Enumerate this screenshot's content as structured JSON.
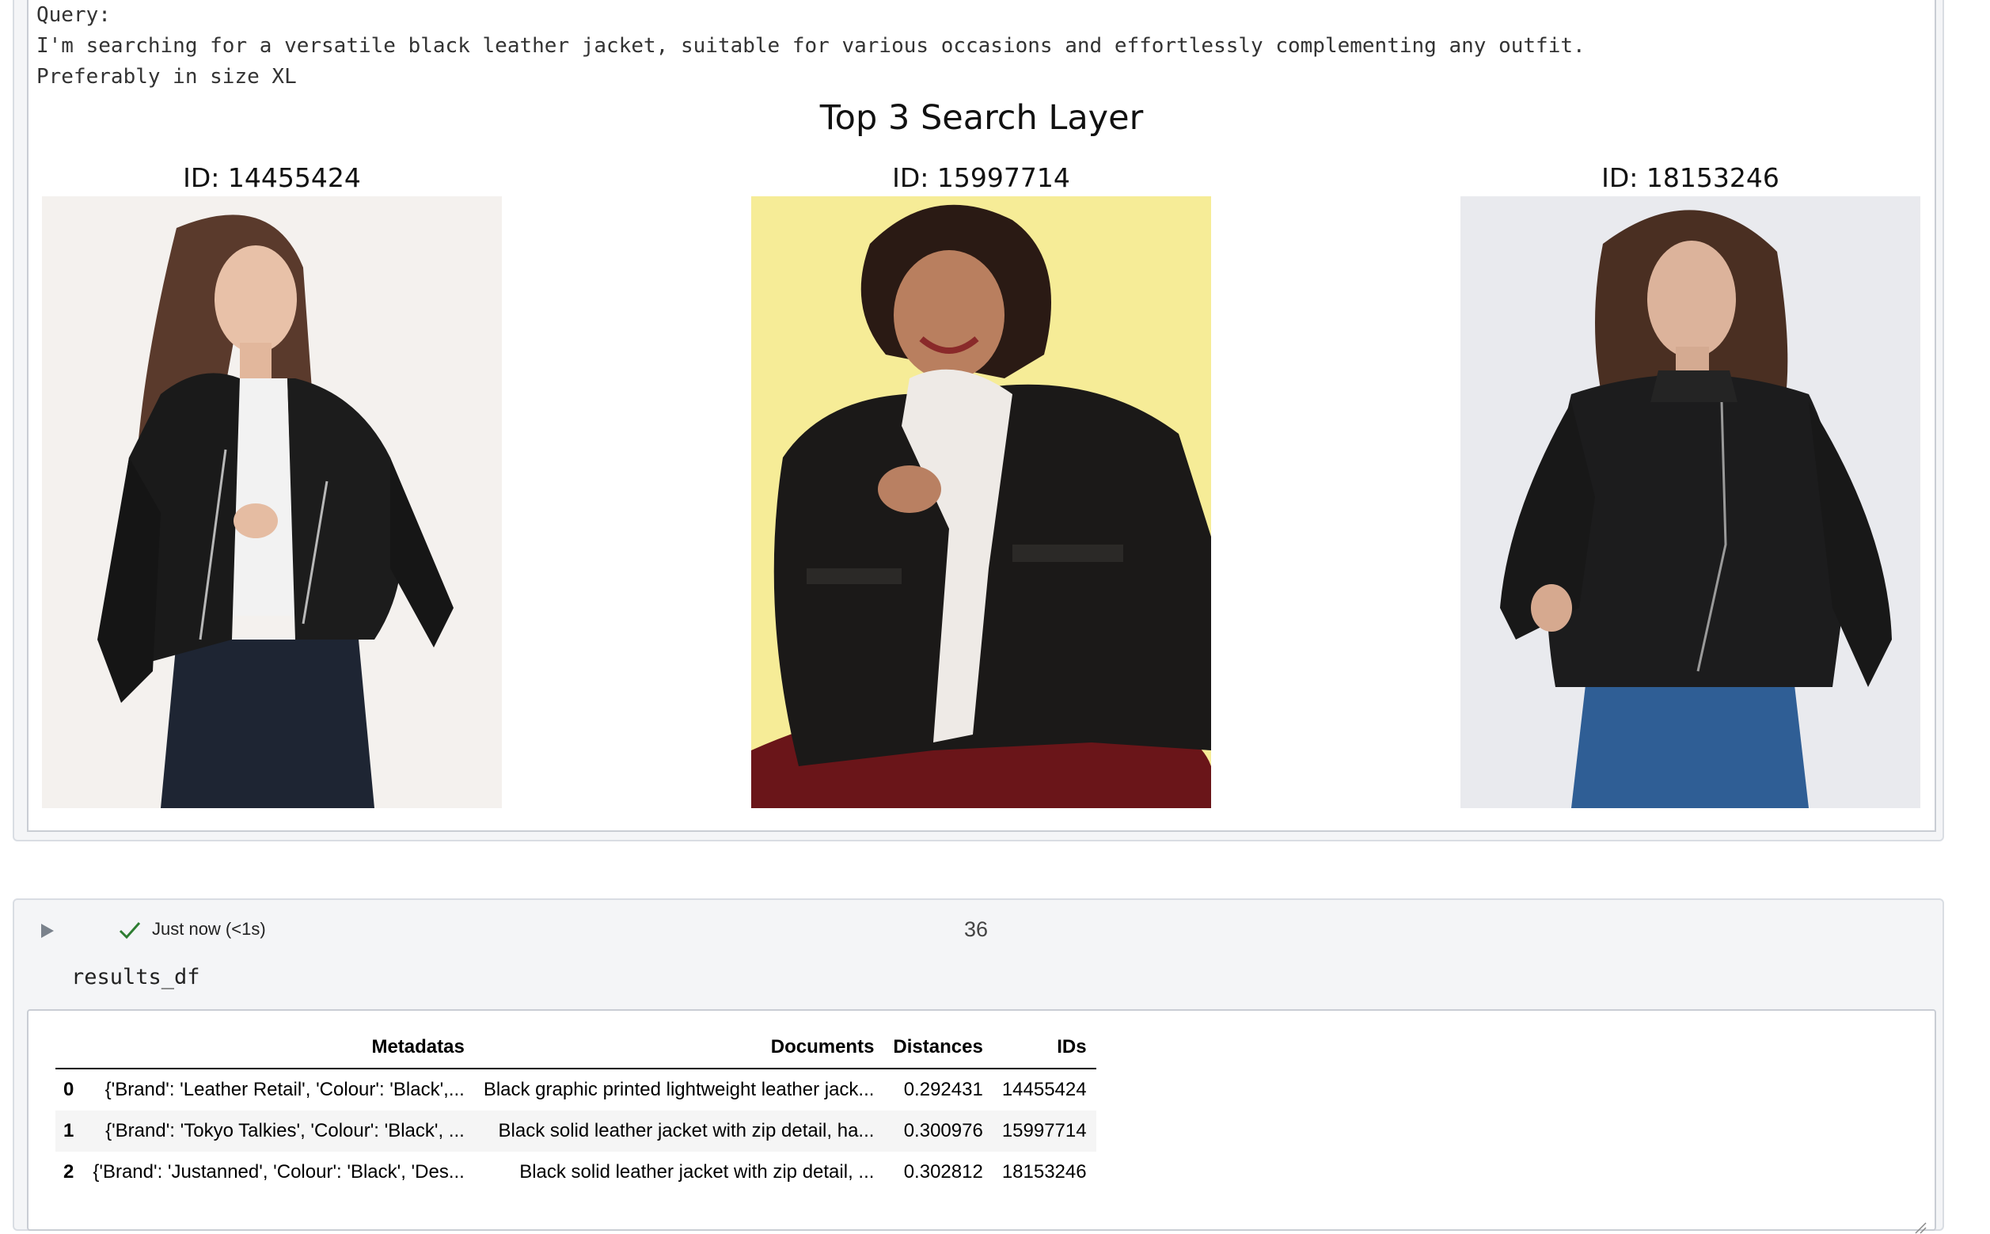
{
  "output": {
    "query_label": "Query:",
    "query_line1": "I'm searching for a versatile black leather jacket, suitable for various occasions and effortlessly complementing any outfit.",
    "query_line2": "Preferably in size XL",
    "figure_title": "Top 3 Search Layer",
    "panels": [
      {
        "id_label": "ID: 14455424",
        "image": "woman-in-black-leather-biker-jacket-photo"
      },
      {
        "id_label": "ID: 15997714",
        "image": "smiling-woman-in-black-leather-jacket-with-shearling-collar-photo"
      },
      {
        "id_label": "ID: 18153246",
        "image": "woman-in-black-leather-jacket-and-jeans-photo"
      }
    ]
  },
  "cell": {
    "run_icon": "play-icon",
    "status_icon": "checkmark-icon",
    "status_text": "Just now (<1s)",
    "execution_count": "36",
    "code": "results_df"
  },
  "dataframe": {
    "columns": [
      "",
      "Metadatas",
      "Documents",
      "Distances",
      "IDs"
    ],
    "rows": [
      {
        "index": "0",
        "metadatas": "{'Brand': 'Leather Retail', 'Colour': 'Black',...",
        "documents": "Black graphic printed lightweight leather jack...",
        "distances": "0.292431",
        "ids": "14455424"
      },
      {
        "index": "1",
        "metadatas": "{'Brand': 'Tokyo Talkies', 'Colour': 'Black', ...",
        "documents": "Black solid leather jacket with zip detail, ha...",
        "distances": "0.300976",
        "ids": "15997714"
      },
      {
        "index": "2",
        "metadatas": "{'Brand': 'Justanned', 'Colour': 'Black', 'Des...",
        "documents": "Black solid leather jacket with zip detail, ...",
        "distances": "0.302812",
        "ids": "18153246"
      }
    ]
  },
  "colors": {
    "status_green": "#2e7d32",
    "cell_border": "#d9dde3",
    "cell_bg": "#f4f5f7"
  }
}
